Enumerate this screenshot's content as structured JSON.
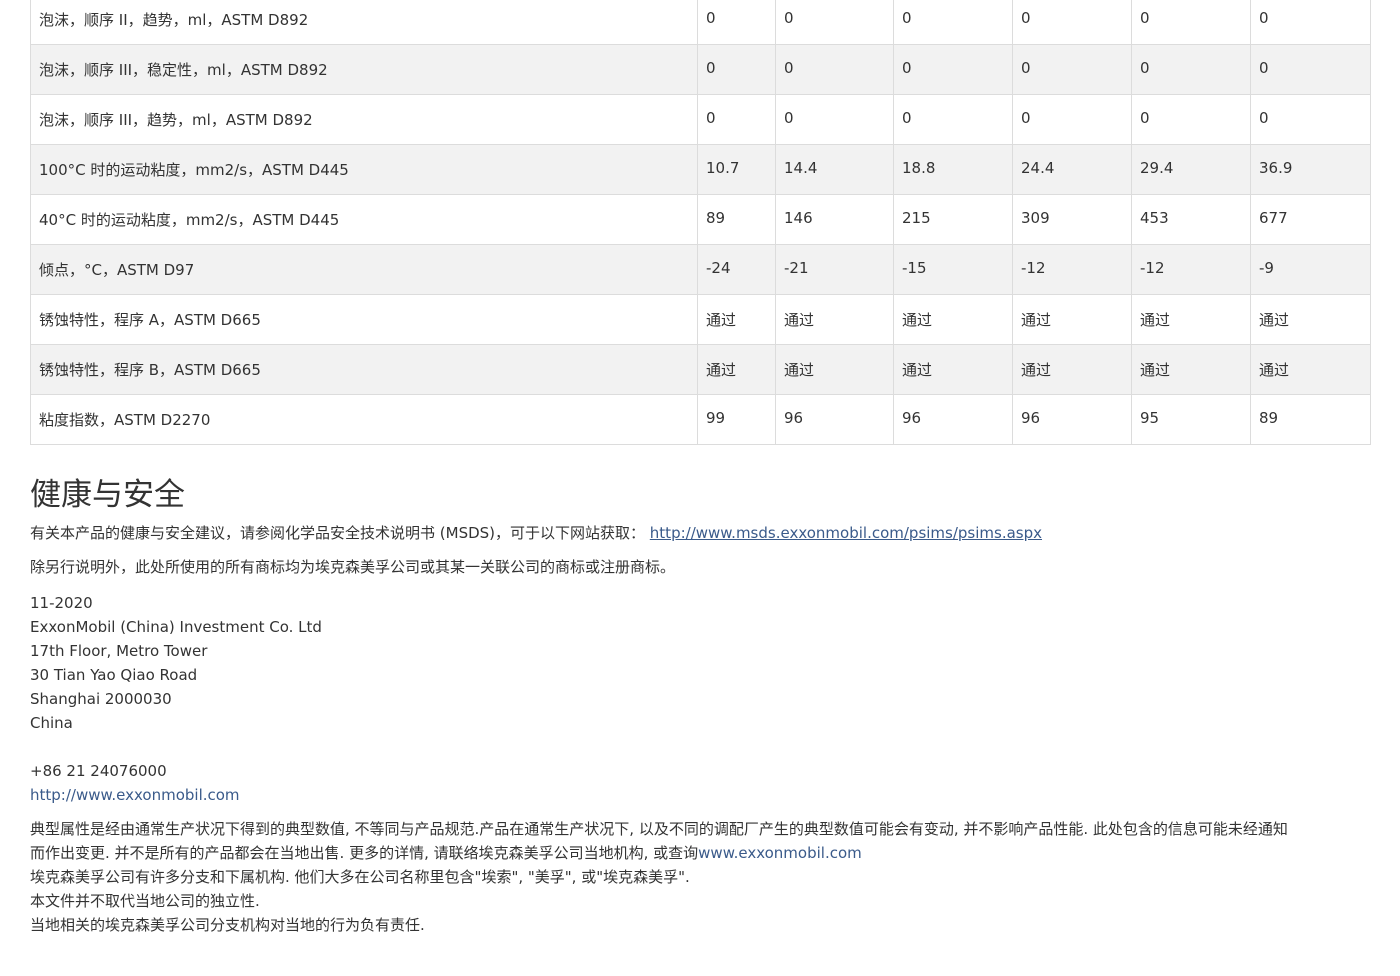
{
  "spec_table": {
    "rows": [
      {
        "property": "泡沫，顺序 II，趋势，ml，ASTM D892",
        "values": [
          "0",
          "0",
          "0",
          "0",
          "0",
          "0"
        ]
      },
      {
        "property": "泡沫，顺序 III，稳定性，ml，ASTM D892",
        "values": [
          "0",
          "0",
          "0",
          "0",
          "0",
          "0"
        ]
      },
      {
        "property": "泡沫，顺序 III，趋势，ml，ASTM D892",
        "values": [
          "0",
          "0",
          "0",
          "0",
          "0",
          "0"
        ]
      },
      {
        "property": "100°C 时的运动粘度，mm2/s，ASTM D445",
        "values": [
          "10.7",
          "14.4",
          "18.8",
          "24.4",
          "29.4",
          "36.9"
        ]
      },
      {
        "property": "40°C 时的运动粘度，mm2/s，ASTM D445",
        "values": [
          "89",
          "146",
          "215",
          "309",
          "453",
          "677"
        ]
      },
      {
        "property": "倾点，°C，ASTM D97",
        "values": [
          "-24",
          "-21",
          "-15",
          "-12",
          "-12",
          "-9"
        ]
      },
      {
        "property": "锈蚀特性，程序 A，ASTM D665",
        "values": [
          "通过",
          "通过",
          "通过",
          "通过",
          "通过",
          "通过"
        ]
      },
      {
        "property": "锈蚀特性，程序 B，ASTM D665",
        "values": [
          "通过",
          "通过",
          "通过",
          "通过",
          "通过",
          "通过"
        ]
      },
      {
        "property": "粘度指数，ASTM D2270",
        "values": [
          "99",
          "96",
          "96",
          "96",
          "95",
          "89"
        ]
      }
    ]
  },
  "health_safety": {
    "title": "健康与安全",
    "msds_text": "有关本产品的健康与安全建议，请参阅化学品安全技术说明书 (MSDS)，可于以下网站获取：",
    "msds_link": "http://www.msds.exxonmobil.com/psims/psims.aspx",
    "trademark_text": "除另行说明外，此处所使用的所有商标均为埃克森美孚公司或其某一关联公司的商标或注册商标。"
  },
  "address": {
    "date": "11-2020",
    "company": "ExxonMobil (China) Investment Co. Ltd",
    "line1": "17th Floor, Metro Tower",
    "line2": "30 Tian Yao Qiao Road",
    "city": "Shanghai 2000030",
    "country": "China",
    "phone": "+86 21 24076000",
    "website": "http://www.exxonmobil.com"
  },
  "disclaimer": {
    "line1": "典型属性是经由通常生产状况下得到的典型数值, 不等同与产品规范.产品在通常生产状况下, 以及不同的调配厂产生的典型数值可能会有变动, 并不影响产品性能. 此处包含的信息可能未经通知",
    "line2_text": "而作出变更. 并不是所有的产品都会在当地出售. 更多的详情, 请联络埃克森美孚公司当地机构, 或查询",
    "line2_link": "www.exxonmobil.com",
    "line3": "埃克森美孚公司有许多分支和下属机构. 他们大多在公司名称里包含\"埃索\", \"美孚\", 或\"埃克森美孚\".",
    "line4": "本文件并不取代当地公司的独立性.",
    "line5": "当地相关的埃克森美孚公司分支机构对当地的行为负有责任."
  }
}
